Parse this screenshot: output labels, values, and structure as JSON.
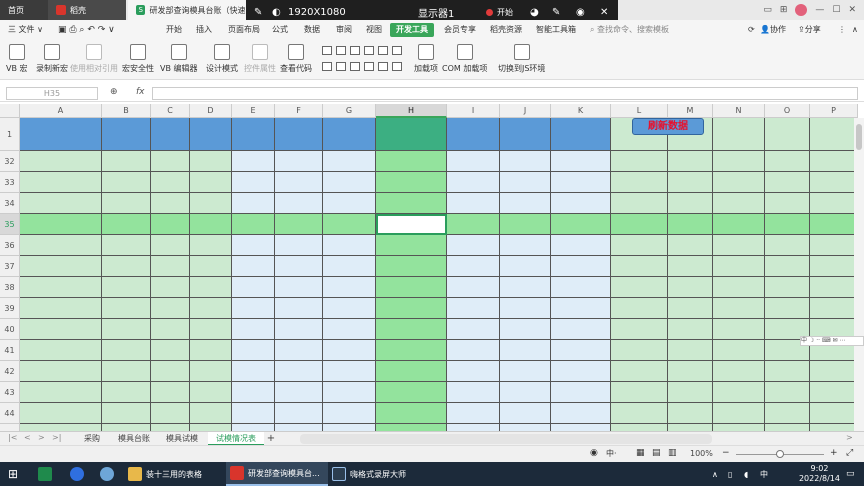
{
  "tabs": {
    "home": "首页",
    "daoke": "稻壳",
    "doc": "研发部查询模具台账（快速）"
  },
  "recorder": {
    "resolution": "1920X1080",
    "display": "显示器1",
    "start": "开始"
  },
  "window": {
    "file_menu": "三 文件 ∨",
    "collab": "协作",
    "share": "分享"
  },
  "menu": {
    "items": [
      "开始",
      "插入",
      "页面布局",
      "公式",
      "数据",
      "审阅",
      "视图",
      "开发工具",
      "会员专享",
      "稻壳资源",
      "智能工具箱"
    ],
    "active": "开发工具",
    "search_placeholder": "查找命令、搜索模板"
  },
  "ribbon": {
    "vb_macro": "VB 宏",
    "record_macro": "录制新宏",
    "relative_ref": "使用相对引用",
    "macro_security": "宏安全性",
    "vb_editor": "VB 编辑器",
    "design_mode": "设计模式",
    "control_props": "控件属性",
    "view_code": "查看代码",
    "addins": "加载项",
    "com_addins": "COM 加载项",
    "switch_js": "切换到JS环境"
  },
  "formula_bar": {
    "cell_ref": "H35",
    "fx": "fx"
  },
  "grid": {
    "columns": [
      "A",
      "B",
      "C",
      "D",
      "E",
      "F",
      "G",
      "H",
      "I",
      "J",
      "K",
      "L",
      "M",
      "N",
      "O",
      "P"
    ],
    "selected_column": "H",
    "rows": [
      "1",
      "32",
      "33",
      "34",
      "35",
      "36",
      "37",
      "38",
      "39",
      "40",
      "41",
      "42",
      "43",
      "44",
      "45"
    ],
    "selected_row": "35",
    "refresh_button": "刷新数据"
  },
  "sheets": {
    "tabs": [
      "采购",
      "模具台账",
      "模具试模",
      "试模情况表"
    ],
    "active": "试模情况表",
    "add": "+"
  },
  "status": {
    "zoom": "100%"
  },
  "taskbar": {
    "items": [
      "装十三用的表格",
      "研发部查询模具台...",
      "嗨格式录屏大师"
    ],
    "time": "9:02",
    "date": "2022/8/14"
  },
  "colors": {
    "accent": "#3aa65a",
    "header_blue": "#5b9ad7",
    "light_green": "#ccead0",
    "light_blue": "#dfedf8",
    "bright_green": "#93e39d",
    "refresh_text": "#e8102c"
  }
}
